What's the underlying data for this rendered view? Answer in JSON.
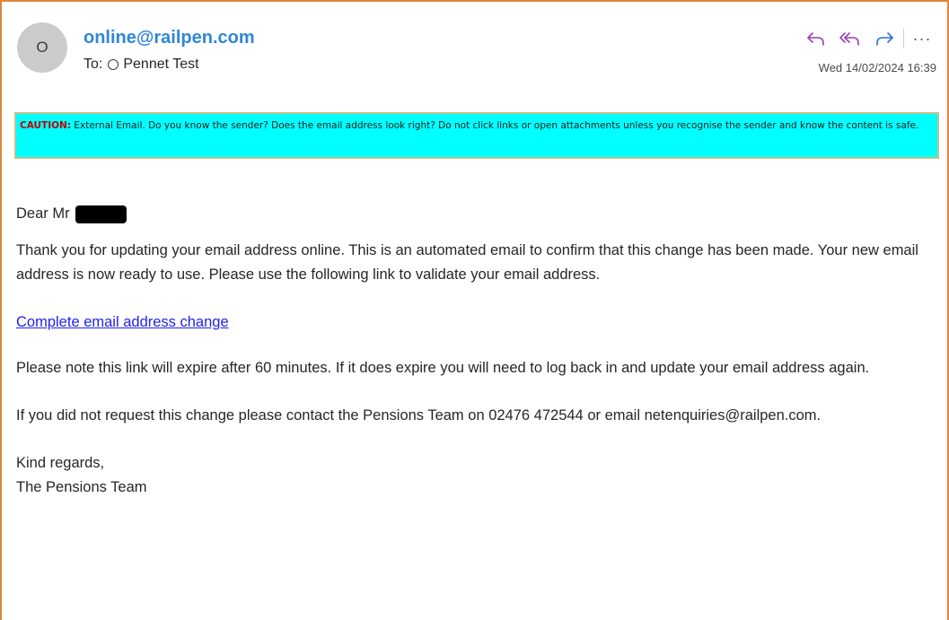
{
  "sender": {
    "avatar_initial": "O",
    "email": "online@railpen.com",
    "to_label": "To:",
    "recipient": "Pennet Test",
    "date": "Wed 14/02/2024 16:39"
  },
  "actions": {
    "more_label": "···"
  },
  "colors": {
    "sender": "#2f87d6",
    "accent_border": "#e2843c",
    "caution_bg": "#00ffff",
    "caution_label": "#c00000",
    "link": "#2222ee"
  },
  "icons": {
    "reply": "reply-icon",
    "reply_all": "reply-all-icon",
    "forward": "forward-icon",
    "more": "more-icon"
  },
  "caution": {
    "label": "CAUTION:",
    "text": " External Email. Do you know the sender? Does the email address look right? Do not click links or open attachments unless you recognise the sender and know the content is safe."
  },
  "body": {
    "greeting": "Dear Mr",
    "paragraph1": "Thank you for updating your email address online. This is an automated email to confirm that this change has been made. Your new email address is now ready to use. Please use the following link to validate your email address.",
    "link_text": "Complete email address change",
    "paragraph2": "Please note this link will expire after 60 minutes. If it does expire you will need to log back in and update your email address again.",
    "paragraph3": "If you did not request this change please contact the Pensions Team on 02476 472544 or email netenquiries@railpen.com.",
    "signoff1": "Kind regards,",
    "signoff2": "The Pensions Team"
  }
}
